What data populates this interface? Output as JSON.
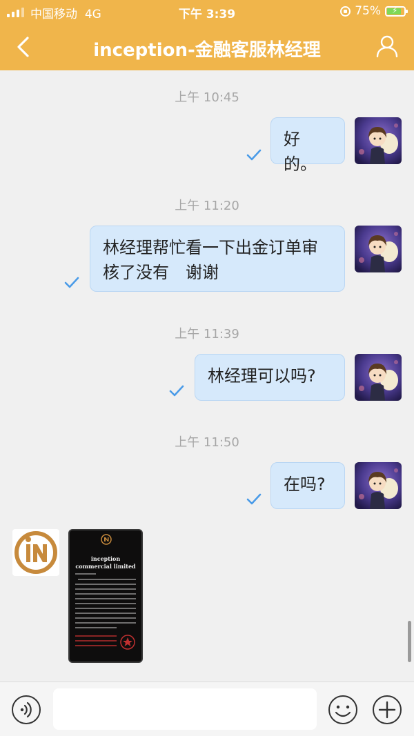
{
  "status_bar": {
    "carrier": "中国移动",
    "network": "4G",
    "time": "下午 3:39",
    "battery": "75%"
  },
  "header": {
    "title": "inception-金融客服林经理"
  },
  "colors": {
    "header_bg": "#f0b54b",
    "bubble_bg": "#d6e9fb",
    "check": "#4a9be8",
    "chat_bg": "#f0f0f0"
  },
  "messages": [
    {
      "timestamp": "上午 10:45",
      "text": "好的。",
      "sender": "me",
      "read": true
    },
    {
      "timestamp": "上午 11:20",
      "text": "林经理帮忙看一下出金订单审核了没有　谢谢",
      "sender": "me",
      "read": true
    },
    {
      "timestamp": "上午 11:39",
      "text": "林经理可以吗?",
      "sender": "me",
      "read": true
    },
    {
      "timestamp": "上午 11:50",
      "text": "在吗?",
      "sender": "me",
      "read": true
    }
  ],
  "incoming": {
    "type": "image",
    "doc_title": "inception commercial limited"
  },
  "input_bar": {
    "placeholder": "",
    "icons": [
      "voice-icon",
      "emoji-icon",
      "plus-icon"
    ]
  }
}
